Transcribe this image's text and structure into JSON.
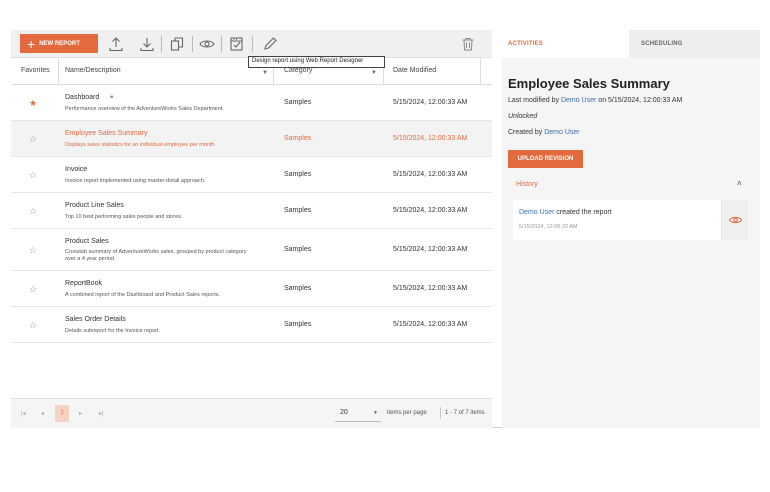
{
  "toolbar": {
    "new_report_label": "NEW REPORT",
    "tooltip": "Design report using Web Report Designer"
  },
  "grid": {
    "columns": {
      "favorites": "Favorites",
      "name": "Name/Description",
      "category": "Category",
      "date": "Date Modified"
    },
    "rows": [
      {
        "favorite": true,
        "name": "Dashboard",
        "locked": true,
        "desc": "Performance overview of the AdventureWorks Sales Department.",
        "category": "Samples",
        "date": "5/15/2024, 12:00:33 AM"
      },
      {
        "favorite": false,
        "name": "Employee Sales Summary",
        "locked": false,
        "desc": "Displays sales statistics for an individual employee per month.",
        "category": "Samples",
        "date": "5/15/2024, 12:00:33 AM"
      },
      {
        "favorite": false,
        "name": "Invoice",
        "locked": false,
        "desc": "Invoice report implemented using master-detail approach.",
        "category": "Samples",
        "date": "5/15/2024, 12:00:33 AM"
      },
      {
        "favorite": false,
        "name": "Product Line Sales",
        "locked": false,
        "desc": "Top 10 best performing sales people and stores.",
        "category": "Samples",
        "date": "5/15/2024, 12:00:33 AM"
      },
      {
        "favorite": false,
        "name": "Product Sales",
        "locked": false,
        "desc": "Crosstab summary of AdventureWorks sales, grouped by product category over a 4 year period.",
        "category": "Samples",
        "date": "5/15/2024, 12:00:33 AM"
      },
      {
        "favorite": false,
        "name": "ReportBook",
        "locked": false,
        "desc": "A combined report of the Dashboard and Product Sales reports.",
        "category": "Samples",
        "date": "5/15/2024, 12:00:33 AM"
      },
      {
        "favorite": false,
        "name": "Sales Order Details",
        "locked": false,
        "desc": "Details subreport for the Invoice report.",
        "category": "Samples",
        "date": "5/15/2024, 12:00:33 AM"
      }
    ],
    "selected_index": 1
  },
  "pager": {
    "current_page": "1",
    "page_size": "20",
    "items_per_page_label": "items per page",
    "info": "1 - 7 of 7 items"
  },
  "panel": {
    "tabs": {
      "activities": "ACTIVITIES",
      "scheduling": "SCHEDULING"
    },
    "title": "Employee Sales Summary",
    "modified_prefix": "Last modified by",
    "modified_user": "Demo User",
    "modified_suffix": "on 5/15/2024, 12:00:33 AM",
    "status": "Unlocked",
    "created_prefix": "Created by",
    "created_user": "Demo User",
    "upload_label": "UPLOAD REVISION",
    "history_label": "History",
    "history_item": {
      "user": "Demo User",
      "action": "created the report",
      "date": "5/15/2024, 12:00:33 AM"
    }
  },
  "colors": {
    "accent": "#e26a3d",
    "link": "#3c6ea8"
  }
}
